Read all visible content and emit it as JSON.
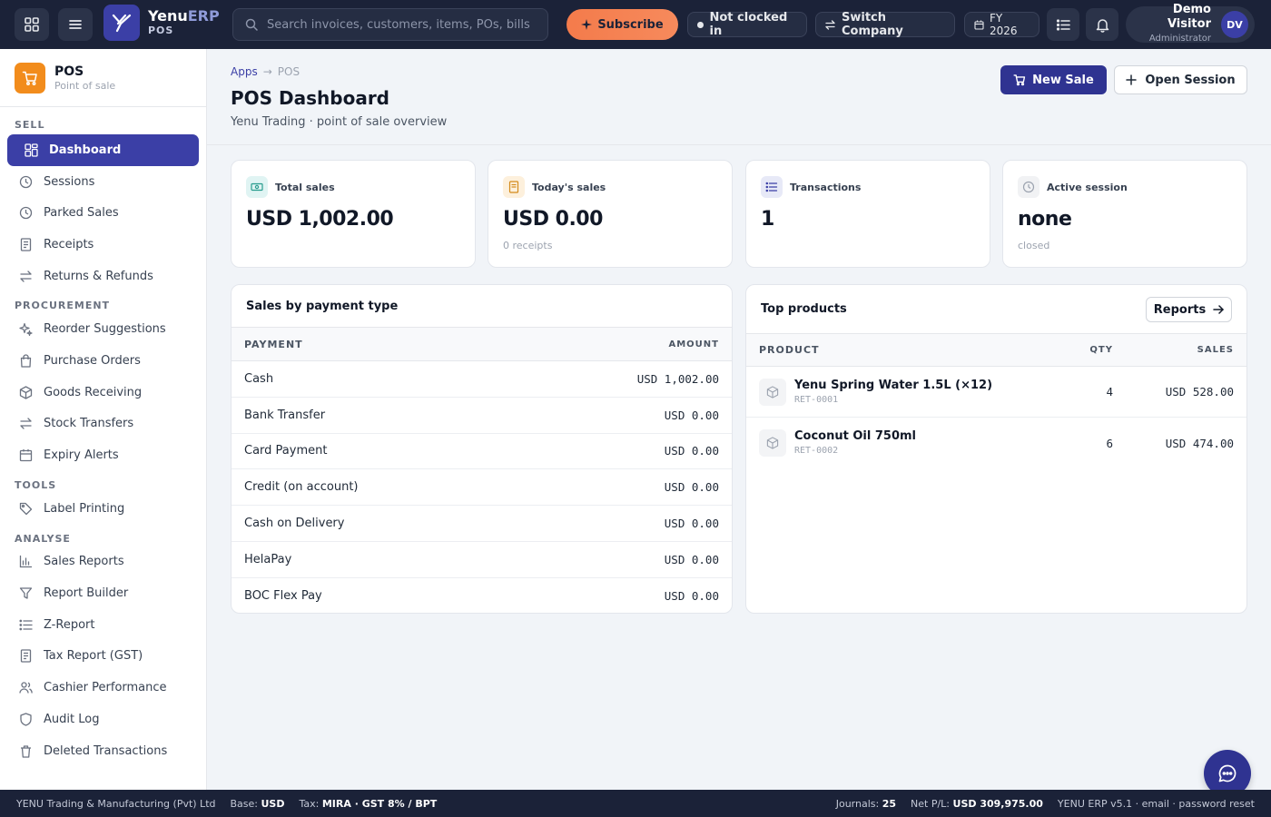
{
  "topbar": {
    "brand_name": "Yenu",
    "brand_name_accent": "ERP",
    "brand_sub": "POS",
    "search_placeholder": "Search invoices, customers, items, POs, bills…",
    "subscribe": "Subscribe",
    "clock_status": "Not clocked in",
    "switch_company": "Switch Company",
    "fiscal_year": "FY 2026",
    "user_name": "Demo Visitor",
    "user_role": "Administrator",
    "user_initials": "DV"
  },
  "sidebar": {
    "app_name": "POS",
    "app_sub": "Point of sale",
    "sections": {
      "sell": "SELL",
      "procurement": "PROCUREMENT",
      "tools": "TOOLS",
      "analyse": "ANALYSE"
    },
    "sell": [
      "Dashboard",
      "Sessions",
      "Parked Sales",
      "Receipts",
      "Returns & Refunds"
    ],
    "procurement": [
      "Reorder Suggestions",
      "Purchase Orders",
      "Goods Receiving",
      "Stock Transfers",
      "Expiry Alerts"
    ],
    "tools": [
      "Label Printing"
    ],
    "analyse": [
      "Sales Reports",
      "Report Builder",
      "Z-Report",
      "Tax Report (GST)",
      "Cashier Performance",
      "Audit Log",
      "Deleted Transactions"
    ]
  },
  "header": {
    "breadcrumb_apps": "Apps",
    "breadcrumb_sep": "→",
    "breadcrumb_current": "POS",
    "title": "POS Dashboard",
    "subtitle": "Yenu Trading · point of sale overview",
    "new_sale": "New Sale",
    "open_session": "Open Session"
  },
  "stats": [
    {
      "label": "Total sales",
      "value": "USD 1,002.00",
      "note": ""
    },
    {
      "label": "Today's sales",
      "value": "USD 0.00",
      "note": "0 receipts"
    },
    {
      "label": "Transactions",
      "value": "1",
      "note": ""
    },
    {
      "label": "Active session",
      "value": "none",
      "note": "closed"
    }
  ],
  "payments": {
    "title": "Sales by payment type",
    "col_payment": "PAYMENT",
    "col_amount": "AMOUNT",
    "rows": [
      {
        "name": "Cash",
        "amount": "USD 1,002.00"
      },
      {
        "name": "Bank Transfer",
        "amount": "USD 0.00"
      },
      {
        "name": "Card Payment",
        "amount": "USD 0.00"
      },
      {
        "name": "Credit (on account)",
        "amount": "USD 0.00"
      },
      {
        "name": "Cash on Delivery",
        "amount": "USD 0.00"
      },
      {
        "name": "HelaPay",
        "amount": "USD 0.00"
      },
      {
        "name": "BOC Flex Pay",
        "amount": "USD 0.00"
      }
    ]
  },
  "top_products": {
    "title": "Top products",
    "reports_btn": "Reports",
    "col_product": "PRODUCT",
    "col_qty": "QTY",
    "col_sales": "SALES",
    "rows": [
      {
        "name": "Yenu Spring Water 1.5L (×12)",
        "sku": "RET-0001",
        "qty": "4",
        "sales": "USD 528.00"
      },
      {
        "name": "Coconut Oil 750ml",
        "sku": "RET-0002",
        "qty": "6",
        "sales": "USD 474.00"
      }
    ]
  },
  "footer": {
    "company": "YENU Trading & Manufacturing (Pvt) Ltd",
    "base_label": "Base:",
    "base_value": "USD",
    "tax_label": "Tax:",
    "tax_value": "MIRA · GST 8% / BPT",
    "journals_label": "Journals:",
    "journals_value": "25",
    "netpl_label": "Net P/L:",
    "netpl_value": "USD 309,975.00",
    "version": "YENU ERP v5.1 · email · password reset"
  },
  "colors": {
    "topbar_bg": "#1b2238",
    "accent": "#3b3fa6",
    "primary_button": "#2f3391",
    "subscribe": "#f47b4b",
    "app_icon": "#f28c1c"
  }
}
